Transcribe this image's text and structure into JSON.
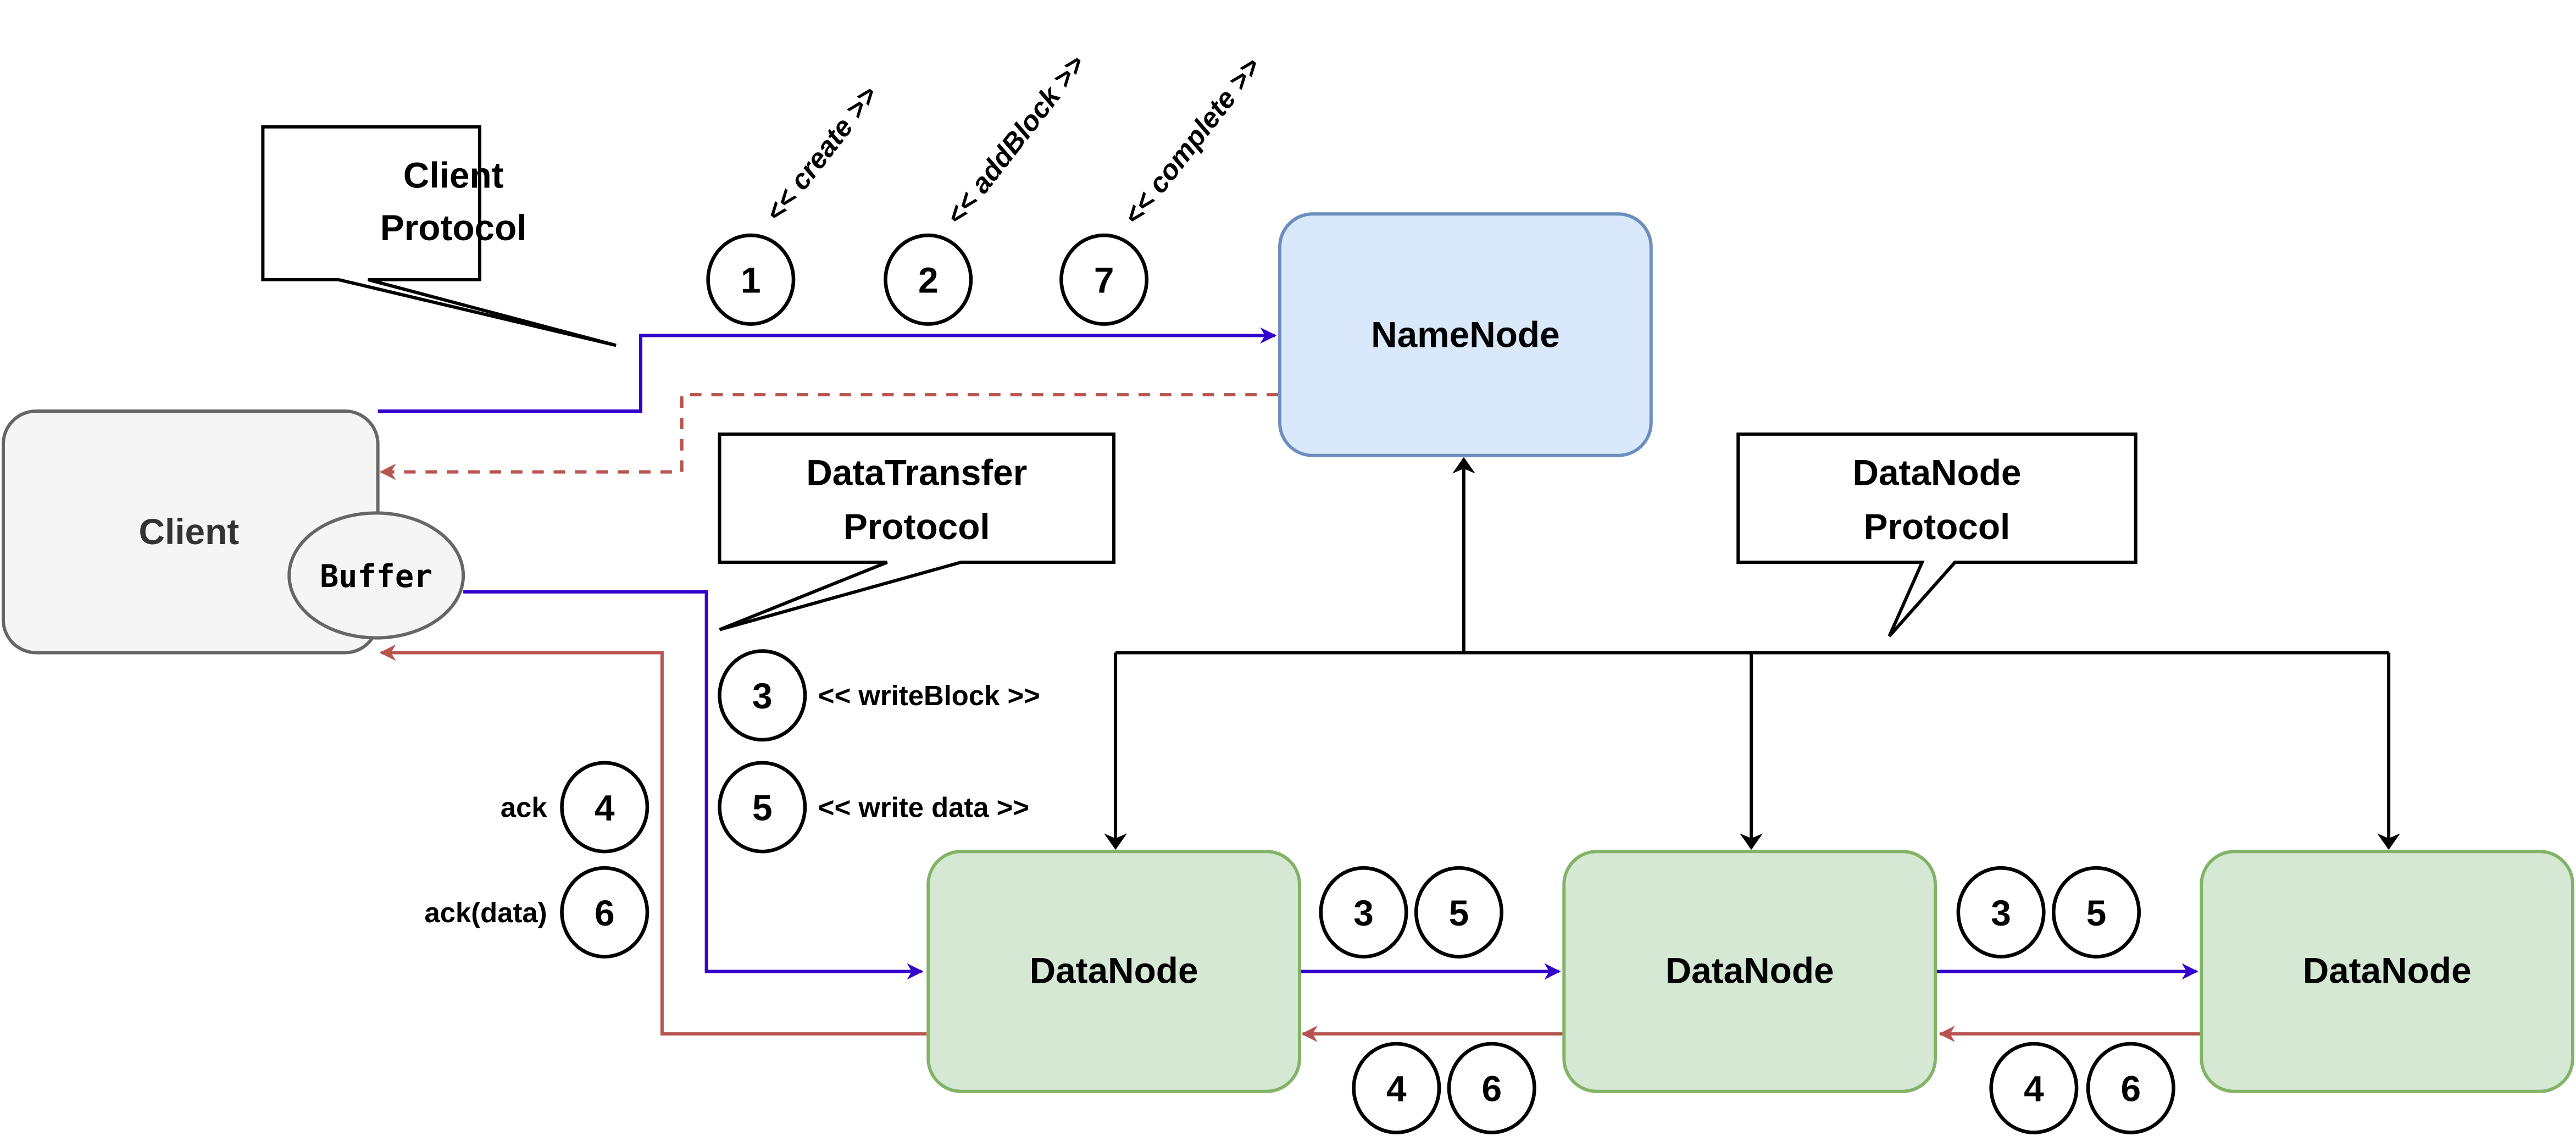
{
  "colors": {
    "blue": "#3300cc",
    "red": "#b85450",
    "namenode_fill": "#dae8fc",
    "namenode_stroke": "#6c8ebf",
    "datanode_fill": "#d5e8d4",
    "datanode_stroke": "#82b366",
    "client_fill": "#f5f5f5",
    "client_stroke": "#666666"
  },
  "nodes": {
    "namenode": "NameNode",
    "client": "Client",
    "buffer": "Buffer",
    "datanode1": "DataNode",
    "datanode2": "DataNode",
    "datanode3": "DataNode"
  },
  "callouts": {
    "client_protocol": [
      "Client",
      "Protocol"
    ],
    "datatransfer_protocol": [
      "DataTransfer",
      "Protocol"
    ],
    "datanode_protocol": [
      "DataNode",
      "Protocol"
    ]
  },
  "steps": {
    "create": {
      "num": "1",
      "label": "<< create >>"
    },
    "addblock": {
      "num": "2",
      "label": "<< addBlock >>"
    },
    "complete": {
      "num": "7",
      "label": "<< complete >>"
    },
    "writeblock": {
      "num": "3",
      "label": "<< writeBlock >>"
    },
    "writedata": {
      "num": "5",
      "label": "<< write data >>"
    },
    "ack": {
      "num": "4",
      "label": "ack"
    },
    "ackdata": {
      "num": "6",
      "label": "ack(data)"
    }
  },
  "pipeline": {
    "fwd": [
      "3",
      "5"
    ],
    "back": [
      "4",
      "6"
    ]
  }
}
